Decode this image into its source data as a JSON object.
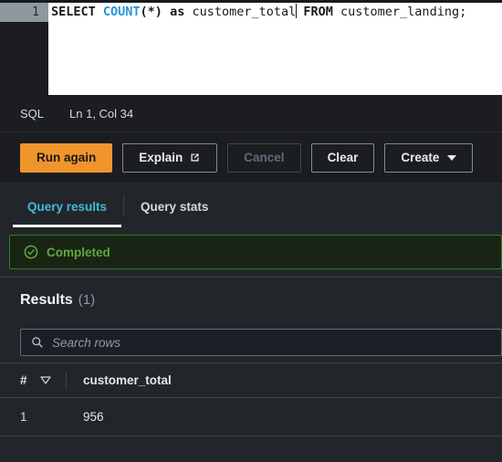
{
  "editor": {
    "line_number": "1",
    "code_tokens": [
      {
        "text": "SELECT ",
        "type": "keyword"
      },
      {
        "text": "COUNT",
        "type": "function"
      },
      {
        "text": "(*) ",
        "type": "punct"
      },
      {
        "text": "as ",
        "type": "keyword"
      },
      {
        "text": "customer_total",
        "type": "plain"
      },
      {
        "text": "caret",
        "type": "caret"
      },
      {
        "text": " ",
        "type": "plain"
      },
      {
        "text": "FROM ",
        "type": "keyword"
      },
      {
        "text": "customer_landing;",
        "type": "plain"
      }
    ],
    "code_plain": "SELECT COUNT(*) as customer_total FROM customer_landing;"
  },
  "status_bar": {
    "language": "SQL",
    "cursor_position": "Ln 1, Col 34"
  },
  "actions": {
    "run_again": "Run again",
    "explain": "Explain",
    "explain_icon": "external-link-icon",
    "cancel": "Cancel",
    "clear": "Clear",
    "create": "Create",
    "create_caret_icon": "chevron-down-icon"
  },
  "tabs": [
    {
      "label": "Query results",
      "active": true
    },
    {
      "label": "Query stats",
      "active": false
    }
  ],
  "banner": {
    "icon": "status-success-icon",
    "text": "Completed"
  },
  "results": {
    "title": "Results",
    "count": "(1)",
    "search_placeholder": "Search rows",
    "search_value": "",
    "search_icon": "search-icon",
    "columns": [
      {
        "label": "#",
        "sort_icon": "sort-descending-icon"
      },
      {
        "label": "customer_total"
      }
    ],
    "rows": [
      {
        "index": "1",
        "customer_total": "956"
      }
    ]
  },
  "colors": {
    "accent_orange": "#f0952b",
    "accent_blue": "#44b9d6",
    "success_green": "#5fa83f",
    "success_bg": "#1a2414",
    "success_border": "#2f7d2f",
    "panel_bg": "#22262b",
    "editor_bg": "#ffffff",
    "chrome_bg": "#1b1d21",
    "sql_function": "#2a93d4"
  }
}
